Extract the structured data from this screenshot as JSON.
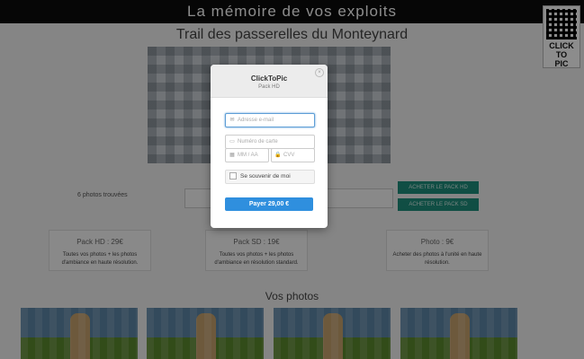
{
  "header": {
    "slogan": "La mémoire de vos exploits"
  },
  "logo": {
    "line1": "CLICK",
    "line2": "TO",
    "line3": "PIC"
  },
  "event": {
    "title": "Trail des passerelles du Monteynard"
  },
  "results": {
    "photos_found": "6 photos trouvées"
  },
  "actions": {
    "buy_hd": "ACHETER LE PACK HD",
    "buy_sd": "ACHETER LE PACK SD"
  },
  "packs": [
    {
      "title": "Pack HD : 29€",
      "desc1": "Toutes vos photos + les photos",
      "desc2": "d'ambiance en haute résolution."
    },
    {
      "title": "Pack SD : 19€",
      "desc1": "Toutes vos photos + les photos",
      "desc2": "d'ambiance en résolution standard."
    },
    {
      "title": "Photo : 9€",
      "desc1": "Acheter des photos à l'unité en haute",
      "desc2": "résolution."
    }
  ],
  "gallery": {
    "title": "Vos photos"
  },
  "modal": {
    "title": "ClickToPic",
    "subtitle": "Pack HD",
    "close_icon": "×",
    "email_placeholder": "Adresse e-mail",
    "card_placeholder": "Numéro de carte",
    "expiry_placeholder": "MM / AA",
    "cvv_placeholder": "CVV",
    "remember_label": "Se souvenir de moi",
    "pay_label": "Payer 29,00 €"
  },
  "colors": {
    "accent": "#2f8fde",
    "buy_buttons": "#1e8f7d",
    "topbar": "#0b0b0b"
  }
}
